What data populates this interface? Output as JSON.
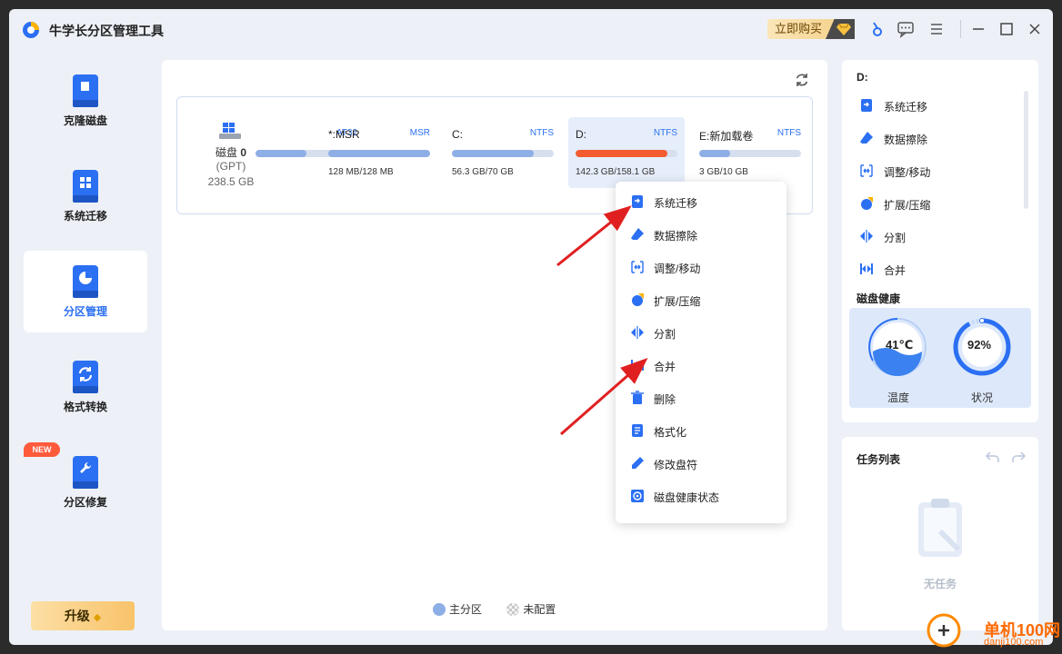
{
  "app": {
    "title": "牛学长分区管理工具",
    "buy_label": "立即购买"
  },
  "titlebar_icons": [
    "pin-icon",
    "feedback-icon",
    "menu-icon",
    "minimize-icon",
    "maximize-icon",
    "close-icon"
  ],
  "sidebar": {
    "items": [
      {
        "label": "克隆磁盘",
        "icon": "clone-disk-icon"
      },
      {
        "label": "系统迁移",
        "icon": "system-migrate-icon"
      },
      {
        "label": "分区管理",
        "icon": "partition-manage-icon",
        "active": true
      },
      {
        "label": "格式转换",
        "icon": "format-convert-icon"
      },
      {
        "label": "分区修复",
        "icon": "partition-repair-icon"
      }
    ],
    "new_badge": "NEW",
    "upgrade_label": "升级"
  },
  "disk": {
    "name_prefix": "磁盘 ",
    "name_num": "0",
    "type": "(GPT)",
    "size": "238.5 GB",
    "partitions": [
      {
        "name": "",
        "fs": "AT32",
        "usage": "",
        "fill": 0.5,
        "partial": true
      },
      {
        "name": "*:MSR",
        "fs": "MSR",
        "usage": "128 MB/128 MB",
        "fill": 1.0
      },
      {
        "name": "C:",
        "fs": "NTFS",
        "usage": "56.3 GB/70 GB",
        "fill": 0.8
      },
      {
        "name": "D:",
        "fs": "NTFS",
        "usage": "142.3 GB/158.1 GB",
        "fill": 0.9,
        "selected": true
      },
      {
        "name": "E:新加载卷",
        "fs": "NTFS",
        "usage": "3 GB/10 GB",
        "fill": 0.3
      }
    ]
  },
  "legend": {
    "primary": "主分区",
    "unallocated": "未配置"
  },
  "context_menu": [
    {
      "label": "系统迁移",
      "icon": "migrate-icon"
    },
    {
      "label": "数据擦除",
      "icon": "eraser-icon"
    },
    {
      "label": "调整/移动",
      "icon": "resize-icon"
    },
    {
      "label": "扩展/压缩",
      "icon": "extend-icon"
    },
    {
      "label": "分割",
      "icon": "split-icon"
    },
    {
      "label": "合并",
      "icon": "merge-icon"
    },
    {
      "label": "删除",
      "icon": "trash-icon"
    },
    {
      "label": "格式化",
      "icon": "format-icon"
    },
    {
      "label": "修改盘符",
      "icon": "pencil-icon"
    },
    {
      "label": "磁盘健康状态",
      "icon": "disk-health-icon"
    }
  ],
  "right_panel": {
    "drive": "D:",
    "ops": [
      {
        "label": "系统迁移",
        "icon": "migrate-icon"
      },
      {
        "label": "数据擦除",
        "icon": "eraser-icon"
      },
      {
        "label": "调整/移动",
        "icon": "resize-icon"
      },
      {
        "label": "扩展/压缩",
        "icon": "extend-icon"
      },
      {
        "label": "分割",
        "icon": "split-icon"
      },
      {
        "label": "合并",
        "icon": "merge-icon"
      }
    ],
    "health_title": "磁盘健康",
    "temperature": {
      "value": "41℃",
      "label": "温度"
    },
    "status": {
      "value": "92%",
      "label": "状况",
      "level": 0.92
    }
  },
  "task_panel": {
    "title": "任务列表",
    "empty": "无任务"
  },
  "watermark": {
    "text": "单机100网",
    "sub": "danji100.com"
  },
  "colors": {
    "accent": "#2b6ff2",
    "selected_bar": "#f25c30",
    "bar": "#8eaee6",
    "arrow": "#e02020"
  }
}
